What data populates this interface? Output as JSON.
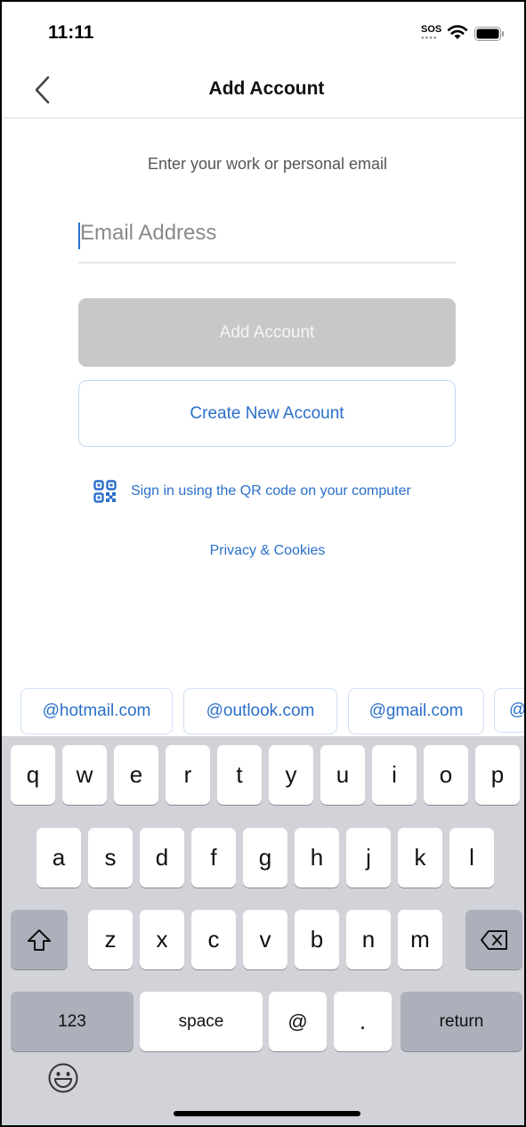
{
  "status_bar": {
    "time": "11:11",
    "sos_label": "SOS",
    "wifi_icon": "wifi-icon",
    "battery_icon": "battery-icon"
  },
  "nav": {
    "back_icon": "chevron-left-icon",
    "title": "Add Account"
  },
  "form": {
    "prompt": "Enter your work or personal email",
    "email_placeholder": "Email Address",
    "email_value": "",
    "add_button_label": "Add Account",
    "add_button_enabled": false,
    "create_button_label": "Create New Account",
    "qr_icon": "qr-code-icon",
    "qr_link_label": "Sign in using the QR code on your computer",
    "privacy_link_label": "Privacy & Cookies"
  },
  "suggestions": [
    "@hotmail.com",
    "@outlook.com",
    "@gmail.com",
    "@"
  ],
  "keyboard": {
    "row1": [
      "q",
      "w",
      "e",
      "r",
      "t",
      "y",
      "u",
      "i",
      "o",
      "p"
    ],
    "row2": [
      "a",
      "s",
      "d",
      "f",
      "g",
      "h",
      "j",
      "k",
      "l"
    ],
    "row3": [
      "z",
      "x",
      "c",
      "v",
      "b",
      "n",
      "m"
    ],
    "shift_icon": "shift-arrow-icon",
    "delete_icon": "backspace-icon",
    "numbers_label": "123",
    "space_label": "space",
    "at_label": "@",
    "period_label": ".",
    "return_label": "return",
    "emoji_icon": "emoji-icon"
  },
  "colors": {
    "accent": "#2a6fc9",
    "disabled_button": "#c8c8c8",
    "keyboard_bg": "#d1d3d9"
  }
}
